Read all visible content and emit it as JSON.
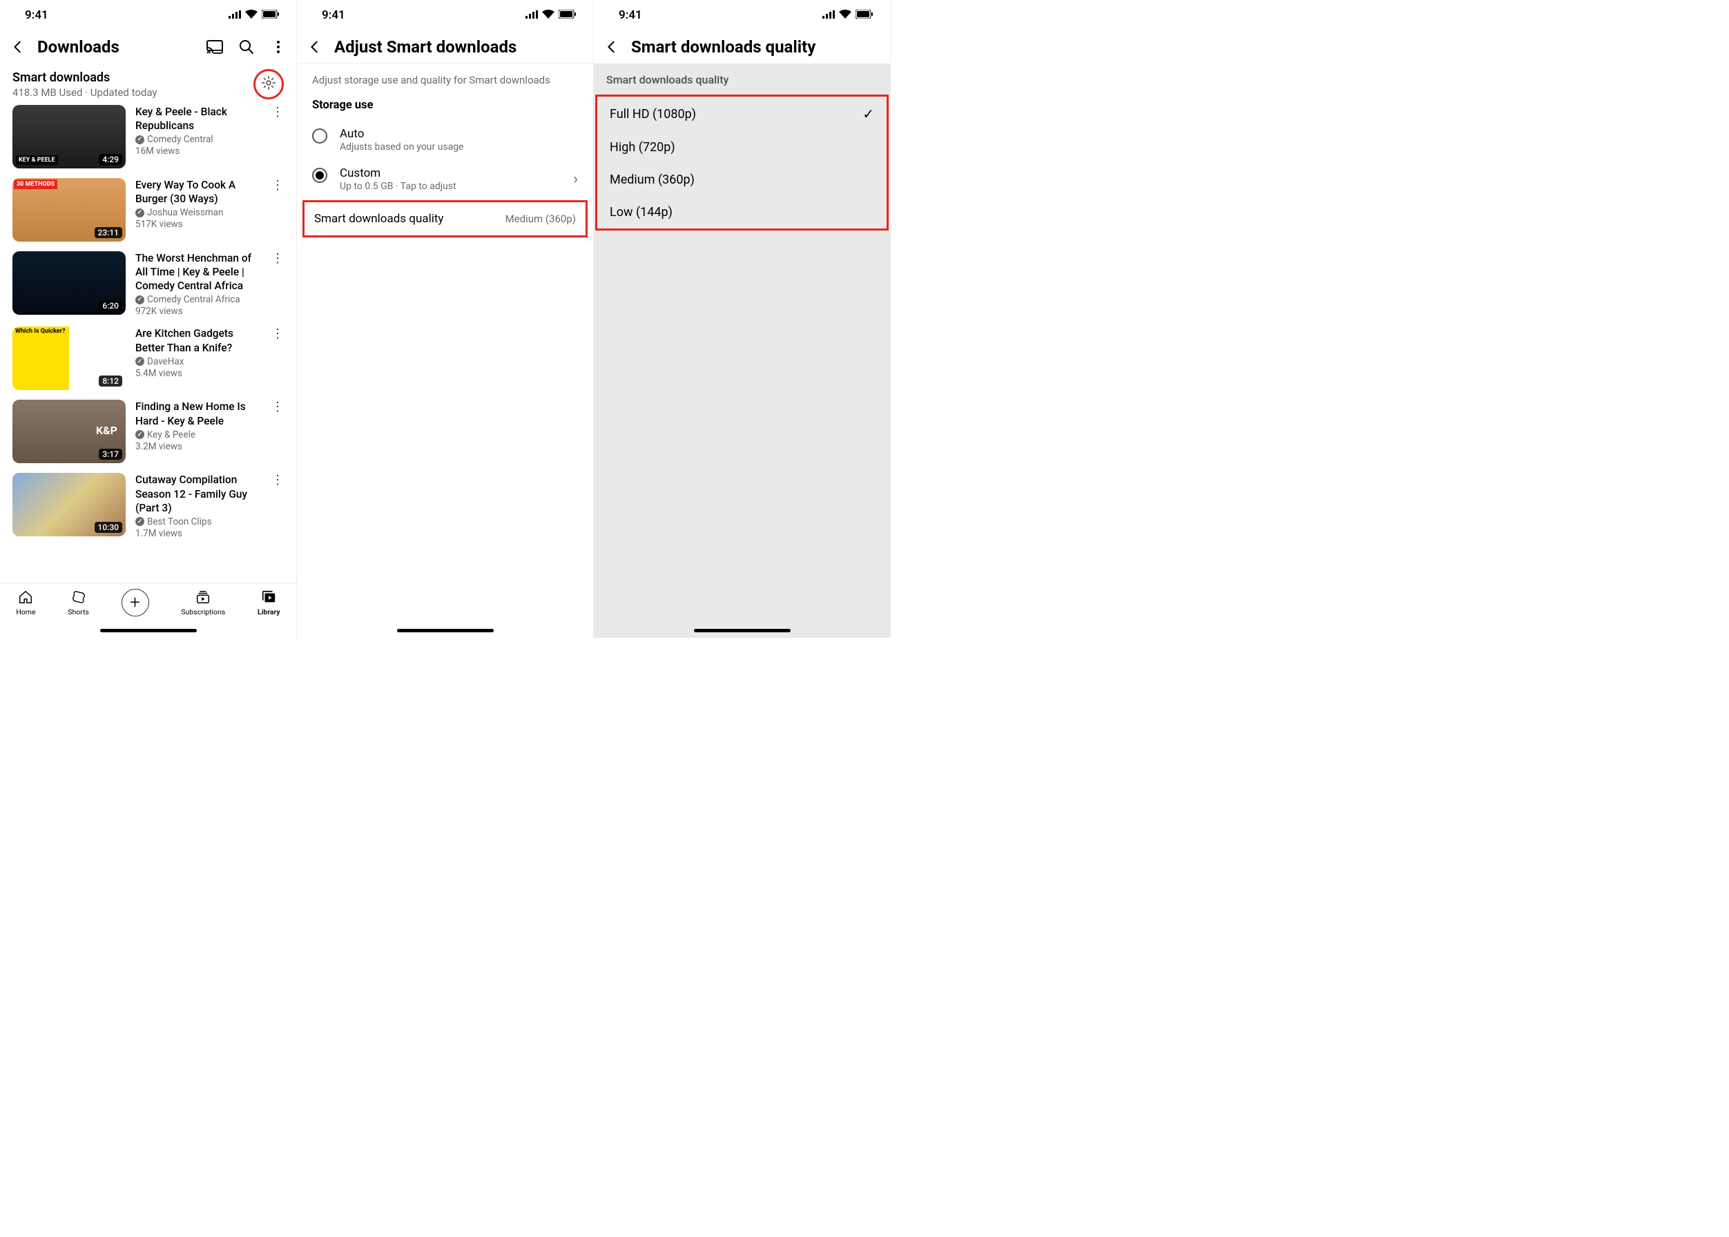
{
  "status": {
    "time": "9:41"
  },
  "screen1": {
    "title": "Downloads",
    "section_title": "Smart downloads",
    "section_sub": "418.3 MB Used · Updated today",
    "videos": [
      {
        "title": "Key & Peele - Black Republicans",
        "channel": "Comedy Central",
        "views": "16M views",
        "duration": "4:29",
        "overlay": "KEY & PEELE"
      },
      {
        "title": "Every Way To Cook A Burger (30 Ways)",
        "channel": "Joshua Weissman",
        "views": "517K views",
        "duration": "23:11",
        "overlay": "30 METHODS"
      },
      {
        "title": "The Worst Henchman of All Time | Key & Peele | Comedy Central Africa",
        "channel": "Comedy Central Africa",
        "views": "972K views",
        "duration": "6:20",
        "overlay": ""
      },
      {
        "title": "Are Kitchen Gadgets Better Than a Knife?",
        "channel": "DaveHax",
        "views": "5.4M views",
        "duration": "8:12",
        "overlay": "Which Is Quicker?"
      },
      {
        "title": "Finding a New Home Is Hard - Key & Peele",
        "channel": "Key & Peele",
        "views": "3.2M views",
        "duration": "3:17",
        "overlay": "K&P"
      },
      {
        "title": "Cutaway Compilation Season 12 - Family Guy (Part 3)",
        "channel": "Best Toon Clips",
        "views": "1.7M views",
        "duration": "10:30",
        "overlay": ""
      }
    ],
    "nav": {
      "home": "Home",
      "shorts": "Shorts",
      "subs": "Subscriptions",
      "library": "Library"
    }
  },
  "screen2": {
    "title": "Adjust Smart downloads",
    "desc": "Adjust storage use and quality for Smart downloads",
    "storage_label": "Storage use",
    "auto": {
      "title": "Auto",
      "sub": "Adjusts based on your usage"
    },
    "custom": {
      "title": "Custom",
      "sub": "Up to 0.5 GB · Tap to adjust"
    },
    "quality_row": {
      "title": "Smart downloads quality",
      "value": "Medium (360p)"
    }
  },
  "screen3": {
    "title": "Smart downloads quality",
    "subtitle": "Smart downloads quality",
    "options": [
      {
        "label": "Full HD (1080p)",
        "selected": true
      },
      {
        "label": "High (720p)",
        "selected": false
      },
      {
        "label": "Medium (360p)",
        "selected": false
      },
      {
        "label": "Low (144p)",
        "selected": false
      }
    ]
  }
}
